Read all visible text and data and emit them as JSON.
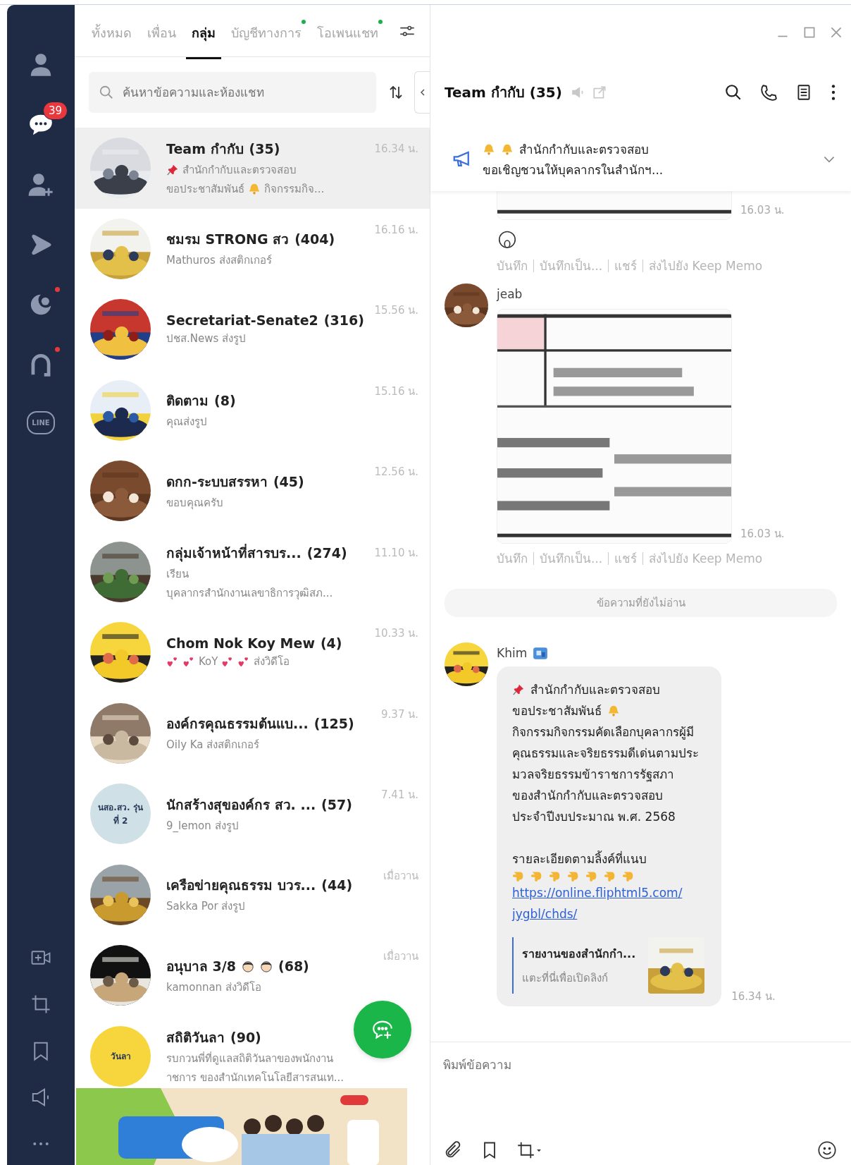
{
  "nav": {
    "top": [
      {
        "kind": "person",
        "selected": false,
        "dot": false
      },
      {
        "kind": "chat",
        "selected": true,
        "dot": false,
        "badge": "39"
      },
      {
        "kind": "add-person",
        "selected": false,
        "dot": false
      },
      {
        "kind": "play",
        "selected": false,
        "dot": false
      },
      {
        "kind": "crescent",
        "selected": false,
        "dot": true
      },
      {
        "kind": "arch",
        "selected": false,
        "dot": true
      },
      {
        "kind": "logo",
        "label": "LINE",
        "selected": false,
        "dot": false
      }
    ],
    "bottom": [
      {
        "kind": "video-plus"
      },
      {
        "kind": "crop"
      },
      {
        "kind": "bookmark"
      },
      {
        "kind": "speaker"
      },
      {
        "kind": "more"
      }
    ]
  },
  "tabs": [
    {
      "label": "ทั้งหมด",
      "selected": false,
      "dot": false
    },
    {
      "label": "เพื่อน",
      "selected": false,
      "dot": false
    },
    {
      "label": "กลุ่ม",
      "selected": true,
      "dot": false
    },
    {
      "label": "บัญชีทางการ",
      "selected": false,
      "dot": true
    },
    {
      "label": "โอเพนแชท",
      "selected": false,
      "dot": true
    }
  ],
  "search": {
    "placeholder": "ค้นหาข้อความและห้องแชท"
  },
  "chats": [
    {
      "name": "Team กำกับ",
      "count": "(35)",
      "time": "16.34 น.",
      "selected": true,
      "avatar": {
        "kind": "picture"
      },
      "preview": [
        [
          {
            "kind": "pin"
          },
          {
            "kind": "text",
            "text": "สำนักกำกับและตรวจสอบ"
          }
        ],
        [
          {
            "kind": "text",
            "text": "ขอประชาสัมพันธ์"
          },
          {
            "kind": "bell"
          },
          {
            "kind": "text",
            "text": "กิจกรรมกิจ..."
          }
        ]
      ]
    },
    {
      "name": "ชมรม STRONG สว",
      "count": "(404)",
      "time": "16.16 น.",
      "selected": false,
      "avatar": {
        "kind": "picture"
      },
      "preview": [
        [
          {
            "kind": "text",
            "text": "Mathuros ส่งสติกเกอร์"
          }
        ]
      ]
    },
    {
      "name": "Secretariat-Senate2",
      "count": "(316)",
      "time": "15.56 น.",
      "selected": false,
      "avatar": {
        "kind": "picture"
      },
      "preview": [
        [
          {
            "kind": "text",
            "text": "ปชส.News ส่งรูป"
          }
        ]
      ]
    },
    {
      "name": "ติดตาม",
      "count": "(8)",
      "time": "15.16 น.",
      "selected": false,
      "avatar": {
        "kind": "picture"
      },
      "preview": [
        [
          {
            "kind": "text",
            "text": "คุณส่งรูป"
          }
        ]
      ]
    },
    {
      "name": "ดกก-ระบบสรรหา",
      "count": "(45)",
      "time": "12.56 น.",
      "selected": false,
      "avatar": {
        "kind": "picture"
      },
      "preview": [
        [
          {
            "kind": "text",
            "text": "ขอบคุณครับ"
          }
        ]
      ]
    },
    {
      "name": "กลุ่มเจ้าหน้าที่สารบร...",
      "count": "(274)",
      "time": "11.10 น.",
      "selected": false,
      "avatar": {
        "kind": "picture"
      },
      "preview": [
        [
          {
            "kind": "text",
            "text": "เรียน"
          }
        ],
        [
          {
            "kind": "text",
            "text": "บุคลากรสำนักงานเลขาธิการวุฒิสภ..."
          }
        ]
      ]
    },
    {
      "name": "Chom Nok Koy Mew",
      "count": "(4)",
      "time": "10.33 น.",
      "selected": false,
      "avatar": {
        "kind": "picture"
      },
      "preview": [
        [
          {
            "kind": "heart"
          },
          {
            "kind": "heart"
          },
          {
            "kind": "text",
            "text": "KoY"
          },
          {
            "kind": "heart"
          },
          {
            "kind": "heart"
          },
          {
            "kind": "text",
            "text": "ส่งวิดีโอ"
          }
        ]
      ]
    },
    {
      "name": "องค์กรคุณธรรมต้นแบ...",
      "count": "(125)",
      "time": "9.37 น.",
      "selected": false,
      "avatar": {
        "kind": "picture"
      },
      "preview": [
        [
          {
            "kind": "text",
            "text": "Oily Ka ส่งสติกเกอร์"
          }
        ]
      ]
    },
    {
      "name": "นักสร้างสุของค์กร สว. ...",
      "count": "(57)",
      "time": "7.41 น.",
      "selected": false,
      "avatar": {
        "kind": "text",
        "text": "นสอ.สว. รุ่นที่ 2"
      },
      "preview": [
        [
          {
            "kind": "text",
            "text": "9_lemon ส่งรูป"
          }
        ]
      ]
    },
    {
      "name": "เครือข่ายคุณธรรม บวร...",
      "count": "(44)",
      "time": "เมื่อวาน",
      "selected": false,
      "avatar": {
        "kind": "picture"
      },
      "preview": [
        [
          {
            "kind": "text",
            "text": "Sakka Por ส่งรูป"
          }
        ]
      ]
    },
    {
      "name": "อนุบาล 3/8",
      "name_icons": [
        {
          "kind": "face"
        },
        {
          "kind": "face"
        }
      ],
      "count": "(68)",
      "time": "เมื่อวาน",
      "selected": false,
      "avatar": {
        "kind": "picture"
      },
      "preview": [
        [
          {
            "kind": "text",
            "text": "kamonnan ส่งวิดีโอ"
          }
        ]
      ]
    },
    {
      "name": "สถิติวันลา",
      "count": "(90)",
      "selected": false,
      "avatar": {
        "kind": "text",
        "text": "วันลา"
      },
      "preview": [
        [
          {
            "kind": "text",
            "text": "รบกวนพี่ที่ดูแลสถิติวันลาของพนักงาน"
          }
        ],
        [
          {
            "kind": "text",
            "text": "าชการ  ของสำนักเทคโนโลยีสารสนเท..."
          }
        ]
      ]
    }
  ],
  "ad_banner": {
    "kind": "picture"
  },
  "chat": {
    "title": "Team กำกับ (35)",
    "announcement": [
      [
        {
          "kind": "bell"
        },
        {
          "kind": "bell"
        },
        {
          "kind": "text",
          "text": "สำนักกำกับและตรวจสอบ"
        }
      ],
      [
        {
          "kind": "text",
          "text": "ขอเชิญชวนให้บุคลากรในสำนักฯ..."
        }
      ]
    ],
    "messages": [
      {
        "time": "16.03 น.",
        "reaction": true,
        "actions": [
          "บันทึก",
          "บันทึกเป็น...",
          "แชร์",
          "ส่งไปยัง Keep Memo"
        ]
      },
      {
        "sender": "jeab",
        "time": "16.03 น.",
        "reaction": false,
        "actions": [
          "บันทึก",
          "บันทึกเป็น...",
          "แชร์",
          "ส่งไปยัง Keep Memo"
        ]
      },
      {
        "kind": "divider",
        "text": "ข้อความที่ยังไม่อ่าน"
      },
      {
        "kind": "text",
        "sender": "Khim",
        "sender_badge": true,
        "time": "16.34 น.",
        "paragraphs": [
          [
            [
              {
                "kind": "pin"
              },
              {
                "kind": "text",
                "text": "สำนักกำกับและตรวจสอบ"
              }
            ],
            [
              {
                "kind": "text",
                "text": "ขอประชาสัมพันธ์"
              },
              {
                "kind": "bell"
              }
            ],
            [
              {
                "kind": "text",
                "text": "กิจกรรมกิจกรรมคัดเลือกบุคลากรผู้มี"
              }
            ],
            [
              {
                "kind": "text",
                "text": "คุณธรรมและจริยธรรมดีเด่นตามประ"
              }
            ],
            [
              {
                "kind": "text",
                "text": "มวลจริยธรรมข้าราชการรัฐสภา"
              }
            ],
            [
              {
                "kind": "text",
                "text": "ของสำนักกำกับและตรวจสอบ"
              }
            ],
            [
              {
                "kind": "text",
                "text": "ประจำปีงบประมาณ พ.ศ. 2568"
              }
            ]
          ],
          [
            [
              {
                "kind": "text",
                "text": "รายละเอียดตามลิ้งค์ที่แนบ"
              }
            ],
            [
              {
                "kind": "point"
              },
              {
                "kind": "point"
              },
              {
                "kind": "point"
              },
              {
                "kind": "point"
              },
              {
                "kind": "point"
              },
              {
                "kind": "point"
              },
              {
                "kind": "point"
              }
            ],
            [
              {
                "kind": "link",
                "text": "https://online.fliphtml5.com/"
              }
            ],
            [
              {
                "kind": "link",
                "text": "jygbl/chds/"
              }
            ]
          ]
        ],
        "preview": {
          "title": "รายงานของสำนักกำ...",
          "subtitle": "แตะที่นี่เพื่อเปิดลิงก์"
        }
      }
    ],
    "composer": {
      "placeholder": "พิมพ์ข้อความ"
    }
  }
}
